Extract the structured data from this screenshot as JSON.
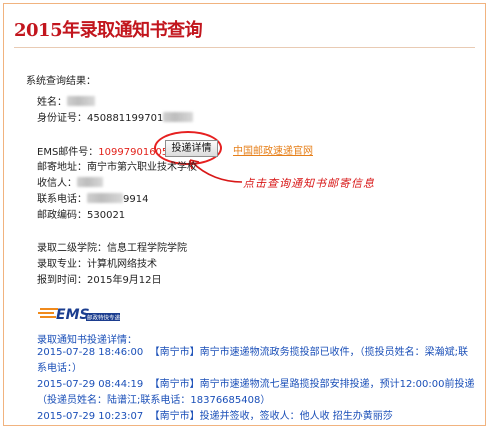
{
  "page": {
    "title": "2015年录取通知书查询",
    "result_label": "系统查询结果："
  },
  "student": {
    "name_label": "姓名：",
    "id_label": "身份证号：",
    "id_value": "450881199701",
    "ems_label": "EMS邮件号：",
    "ems_number": "1099790160513",
    "track_button": "投递详情",
    "ems_site_link": "中国邮政速递官网",
    "address_label": "邮寄地址：",
    "address_value": "南宁市第六职业技术学校",
    "receiver_label": "收信人：",
    "phone_label": "联系电话：",
    "phone_value": "9914",
    "postcode_label": "邮政编码：",
    "postcode_value": "530021",
    "college_label": "录取二级学院：",
    "college_value": "信息工程学院学院",
    "major_label": "录取专业：",
    "major_value": "计算机网络技术",
    "report_label": "报到时间：",
    "report_value": "2015年9月12日"
  },
  "annotation": {
    "note": "点击查询通知书邮寄信息"
  },
  "tracking": {
    "logo_text": "EMS",
    "logo_sub": "邮政特快专递",
    "header": "录取通知书投递详情：",
    "events": [
      {
        "time": "2015-07-28 18:46:00",
        "city": "【南宁市】",
        "desc": "南宁市速递物流政务揽投部已收件，（揽投员姓名：梁瀚斌;联系电话：）"
      },
      {
        "time": "2015-07-29 08:44:19",
        "city": "【南宁市】",
        "desc": "南宁市速递物流七星路揽投部安排投递，预计12:00:00前投递（投递员姓名：陆谱江;联系电话：18376685408）"
      },
      {
        "time": "2015-07-29 10:23:07",
        "city": "【南宁市】",
        "desc": "投递并签收，签收人：他人收 招生办黄丽莎"
      }
    ]
  },
  "colors": {
    "title_red": "#c2151d",
    "ems_red": "#e2221b",
    "link_orange": "#e67f19",
    "track_blue": "#1a4fb8",
    "panel_border": "#f1b37f"
  }
}
